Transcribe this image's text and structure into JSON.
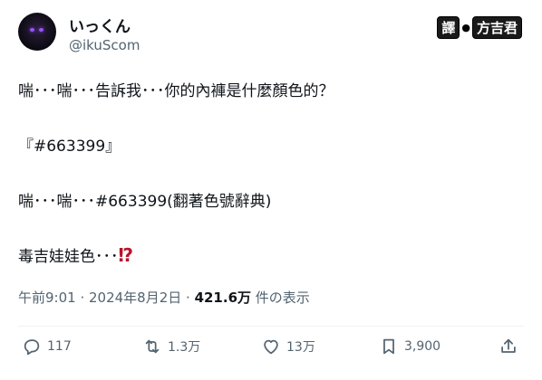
{
  "author": {
    "display_name": "いっくん",
    "handle": "@ikuScom"
  },
  "translator_badge": {
    "tag": "譯",
    "name": "方吉君"
  },
  "post": {
    "line1": "喘･･･喘･･･告訴我･･･你的內褲是什麼顏色的？",
    "line2": "『#663399』",
    "line3": "喘･･･喘･･･#663399(翻著色號辭典)",
    "line4": "毒吉娃娃色･･･",
    "line4_mark": "⁉"
  },
  "meta": {
    "datetime": "午前9:01 · 2024年8月2日 · ",
    "views_count": "421.6万",
    "views_label": " 件の表示"
  },
  "actions": {
    "replies": "117",
    "reposts": "1.3万",
    "likes": "13万",
    "bookmarks": "3,900"
  },
  "icons": [
    "reply-icon",
    "repost-icon",
    "like-icon",
    "bookmark-icon",
    "share-icon"
  ],
  "colors": {
    "text": "#0f1419",
    "secondary": "#536471",
    "accent_mark": "#b7132b"
  }
}
